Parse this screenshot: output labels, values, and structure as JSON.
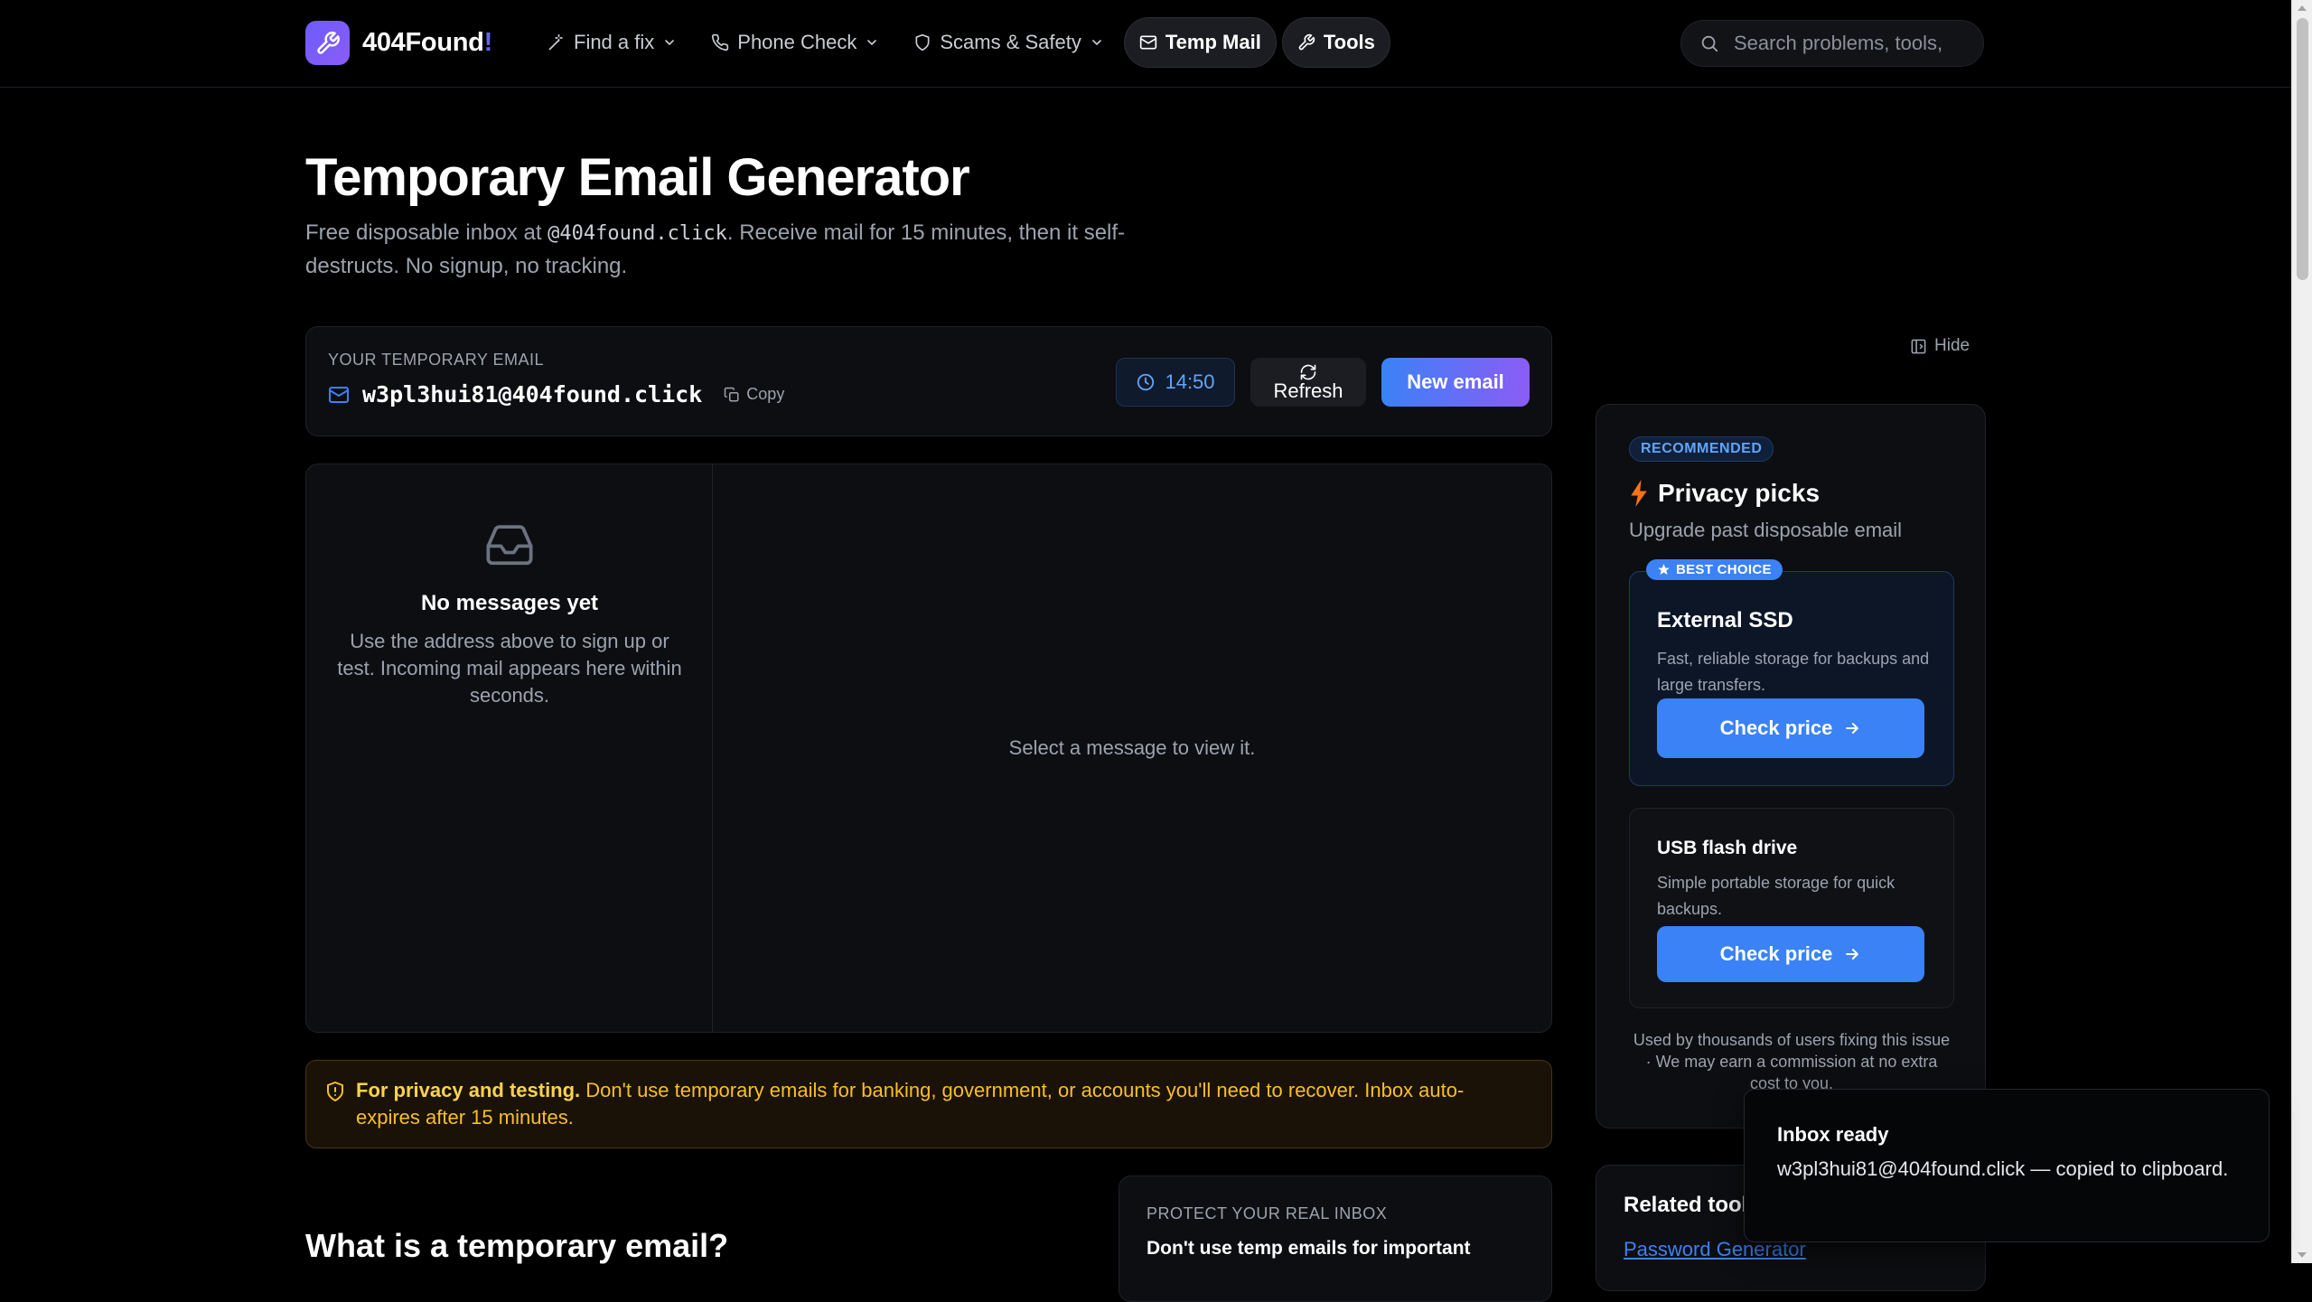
{
  "header": {
    "logo_text": "404Found",
    "logo_suffix": "!",
    "nav": [
      {
        "label": "Find a fix",
        "icon": "wand-icon",
        "dropdown": true
      },
      {
        "label": "Phone Check",
        "icon": "phone-icon",
        "dropdown": true
      },
      {
        "label": "Scams & Safety",
        "icon": "shield-icon",
        "dropdown": true
      },
      {
        "label": "Temp Mail",
        "icon": "mail-icon",
        "active": true
      },
      {
        "label": "Tools",
        "icon": "wrench-icon",
        "active": true
      }
    ],
    "search_placeholder": "Search problems, tools,"
  },
  "hero": {
    "title": "Temporary Email Generator",
    "subtitle_pre": "Free disposable inbox at ",
    "subtitle_domain": "@404found.click",
    "subtitle_post": ". Receive mail for 15 minutes, then it self-destructs. No signup, no tracking."
  },
  "email_card": {
    "label": "YOUR TEMPORARY EMAIL",
    "address": "w3pl3hui81@404found.click",
    "copy_label": "Copy",
    "timer": "14:50",
    "refresh_label": "Refresh",
    "new_label": "New email"
  },
  "inbox": {
    "empty_title": "No messages yet",
    "empty_text": "Use the address above to sign up or test. Incoming mail appears here within seconds.",
    "viewer_placeholder": "Select a message to view it."
  },
  "warning": {
    "bold": "For privacy and testing.",
    "text": " Don't use temporary emails for banking, government, or accounts you'll need to recover. Inbox auto-expires after 15 minutes."
  },
  "section": {
    "what_title": "What is a temporary email?"
  },
  "protect": {
    "label": "PROTECT YOUR REAL INBOX",
    "title": "Don't use temp emails for important"
  },
  "sidebar": {
    "hide_label": "Hide",
    "badge": "RECOMMENDED",
    "title": "Privacy picks",
    "subtitle": "Upgrade past disposable email",
    "products": [
      {
        "badge": "BEST CHOICE",
        "name": "External SSD",
        "desc": "Fast, reliable storage for backups and large transfers.",
        "cta": "Check price"
      },
      {
        "name": "USB flash drive",
        "desc": "Simple portable storage for quick backups.",
        "cta": "Check price"
      }
    ],
    "footer": "Used by thousands of users fixing this issue · We may earn a commission at no extra cost to you."
  },
  "related": {
    "title": "Related tools",
    "link": "Password Generator"
  },
  "toast": {
    "title": "Inbox ready",
    "message": "w3pl3hui81@404found.click — copied to clipboard."
  },
  "colors": {
    "accent": "#3b82f6",
    "brand": "#7c5cff",
    "warning": "#fbbf24",
    "background": "#000000"
  }
}
